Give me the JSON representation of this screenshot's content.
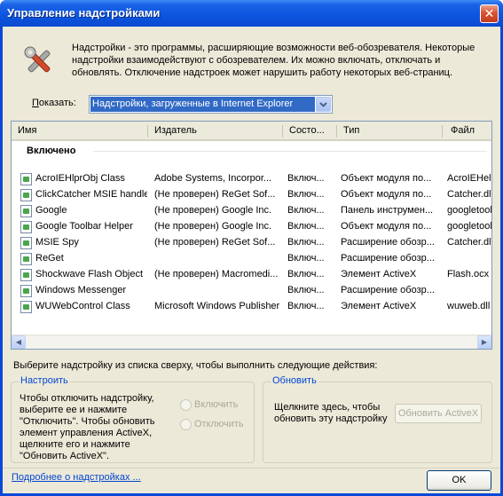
{
  "window": {
    "title": "Управление надстройками",
    "close_label": "✕"
  },
  "intro": {
    "text": "Надстройки - это программы, расширяющие возможности веб-обозревателя. Некоторые надстройки взаимодействуют с обозревателем. Их можно включать, отключать и обновлять. Отключение надстроек может нарушить работу некоторых веб-страниц."
  },
  "filter": {
    "label_prefix": "П",
    "label_rest": "оказать:",
    "selected": "Надстройки, загруженные в Internet Explorer"
  },
  "list": {
    "columns": [
      "Имя",
      "Издатель",
      "Состо...",
      "Тип",
      "Файл"
    ],
    "group_title": "Включено",
    "rows": [
      {
        "name": "AcroIEHlprObj Class",
        "publisher": "Adobe Systems, Incorpor...",
        "status": "Включ...",
        "type": "Объект модуля по...",
        "file": "AcroIEHelp"
      },
      {
        "name": "ClickCatcher MSIE handler",
        "publisher": "(Не проверен) ReGet Sof...",
        "status": "Включ...",
        "type": "Объект модуля по...",
        "file": "Catcher.dll"
      },
      {
        "name": "Google",
        "publisher": "(Не проверен) Google Inc.",
        "status": "Включ...",
        "type": "Панель инструмен...",
        "file": "googletool"
      },
      {
        "name": "Google Toolbar Helper",
        "publisher": "(Не проверен) Google Inc.",
        "status": "Включ...",
        "type": "Объект модуля по...",
        "file": "googletool"
      },
      {
        "name": "MSIE Spy",
        "publisher": "(Не проверен) ReGet Sof...",
        "status": "Включ...",
        "type": "Расширение обозр...",
        "file": "Catcher.dll"
      },
      {
        "name": "ReGet",
        "publisher": "",
        "status": "Включ...",
        "type": "Расширение обозр...",
        "file": ""
      },
      {
        "name": "Shockwave Flash Object",
        "publisher": "(Не проверен) Macromedi...",
        "status": "Включ...",
        "type": "Элемент ActiveX",
        "file": "Flash.ocx"
      },
      {
        "name": "Windows Messenger",
        "publisher": "",
        "status": "Включ...",
        "type": "Расширение обозр...",
        "file": ""
      },
      {
        "name": "WUWebControl Class",
        "publisher": "Microsoft Windows Publisher",
        "status": "Включ...",
        "type": "Элемент ActiveX",
        "file": "wuweb.dll"
      }
    ]
  },
  "instruction": "Выберите надстройку из списка сверху, чтобы выполнить следующие действия:",
  "configure": {
    "title": "Настроить",
    "text_lines": [
      "Чтобы отключить надстройку,",
      "выберите ее и нажмите",
      "\"Отключить\". Чтобы обновить",
      "элемент управления ActiveX,",
      "щелкните его и нажмите",
      "\"Обновить ActiveX\"."
    ],
    "enable_label": "Включить",
    "disable_label": "Отключить"
  },
  "update": {
    "title": "Обновить",
    "text_lines": [
      "Щелкните здесь, чтобы",
      "обновить эту надстройку"
    ],
    "button_label": "Обновить ActiveX"
  },
  "footer": {
    "link": "Подробнее о надстройках ...",
    "ok_label": "OK"
  }
}
